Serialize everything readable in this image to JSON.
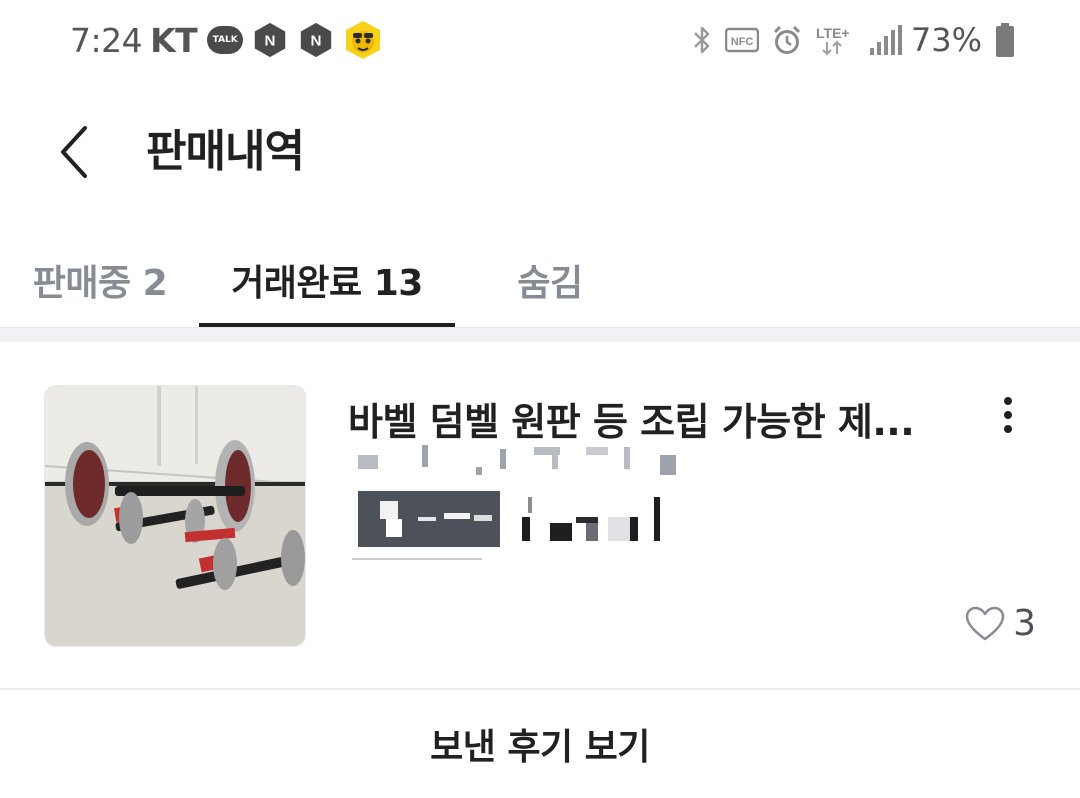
{
  "status_bar": {
    "time": "7:24",
    "carrier": "KT",
    "talk_icon_label": "TALK",
    "notification_icons": [
      "kakaotalk-icon",
      "naver-icon",
      "naver-icon",
      "kakao-character-icon"
    ],
    "system_icons": [
      "bluetooth-icon",
      "nfc-icon",
      "alarm-icon",
      "lte-plus-icon",
      "signal-icon"
    ],
    "nfc_label": "NFC",
    "network_label": "LTE+",
    "battery_percent": "73%",
    "battery_level": 0.73
  },
  "header": {
    "back_icon": "chevron-left-icon",
    "title": "판매내역"
  },
  "tabs": [
    {
      "label": "판매중 2",
      "active": false
    },
    {
      "label": "거래완료 13",
      "active": true
    },
    {
      "label": "숨김",
      "active": false
    }
  ],
  "item": {
    "title": "바벨 덤벨 원판 등 조립 가능한 제...",
    "like_count": "3",
    "like_icon": "heart-outline-icon",
    "more_icon": "more-vertical-icon"
  },
  "footer": {
    "review_button_label": "보낸 후기 보기"
  },
  "colors": {
    "text_primary": "#212124",
    "text_inactive": "#868b94",
    "divider": "#f2f3f6"
  }
}
